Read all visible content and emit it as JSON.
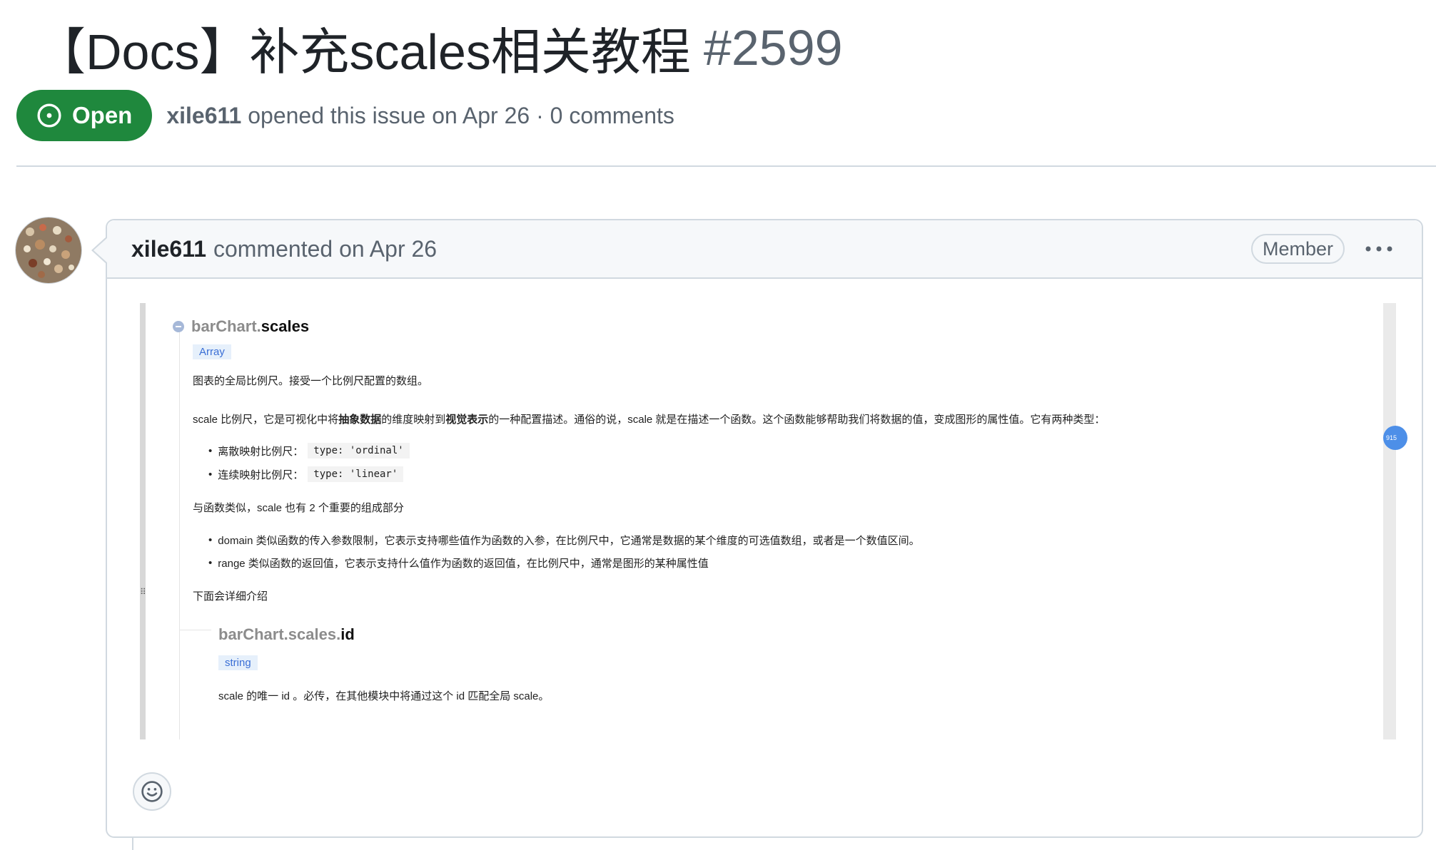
{
  "issue": {
    "title": "【Docs】补充scales相关教程",
    "number": "#2599",
    "status_label": "Open",
    "author": "xile611",
    "opened_text": "opened this issue on Apr 26 · 0 comments"
  },
  "comment": {
    "author": "xile611",
    "action_text": "commented on Apr 26",
    "role_badge": "Member",
    "more_icon": "kebab-horizontal-icon",
    "reaction_icon": "smiley-icon"
  },
  "doc": {
    "heading_prefix": "barChart.",
    "heading_name": "scales",
    "type_tag": "Array",
    "summary": "图表的全局比例尺。接受一个比例尺配置的数组。",
    "intro_1": "scale 比例尺，它是可视化中将",
    "intro_bold_1": "抽象数据",
    "intro_2": "的维度映射到",
    "intro_bold_2": "视觉表示",
    "intro_3": "的一种配置描述。通俗的说，scale 就是在描述一个函数。这个函数能够帮助我们将数据的值，变成图形的属性值。它有两种类型：",
    "types": [
      {
        "label": "离散映射比例尺：",
        "code": "type: 'ordinal'"
      },
      {
        "label": "连续映射比例尺：",
        "code": "type: 'linear'"
      }
    ],
    "components_intro": "与函数类似，scale 也有 2 个重要的组成部分",
    "components": [
      "domain 类似函数的传入参数限制，它表示支持哪些值作为函数的入参，在比例尺中，它通常是数据的某个维度的可选值数组，或者是一个数值区间。",
      "range 类似函数的返回值，它表示支持什么值作为函数的返回值，在比例尺中，通常是图形的某种属性值"
    ],
    "more_text": "下面会详细介绍",
    "sub_prefix": "barChart.scales.",
    "sub_name": "id",
    "sub_type_tag": "string",
    "sub_desc": "scale 的唯一 id 。必传，在其他模块中将通过这个 id 匹配全局 scale。",
    "float_badge": "915",
    "drag_handle": "⠿"
  },
  "colors": {
    "open_green": "#1f883d",
    "muted_text": "#59636e",
    "border": "#d1d9e0",
    "header_bg": "#f6f8fa",
    "tag_blue": "#3b6fd6"
  }
}
